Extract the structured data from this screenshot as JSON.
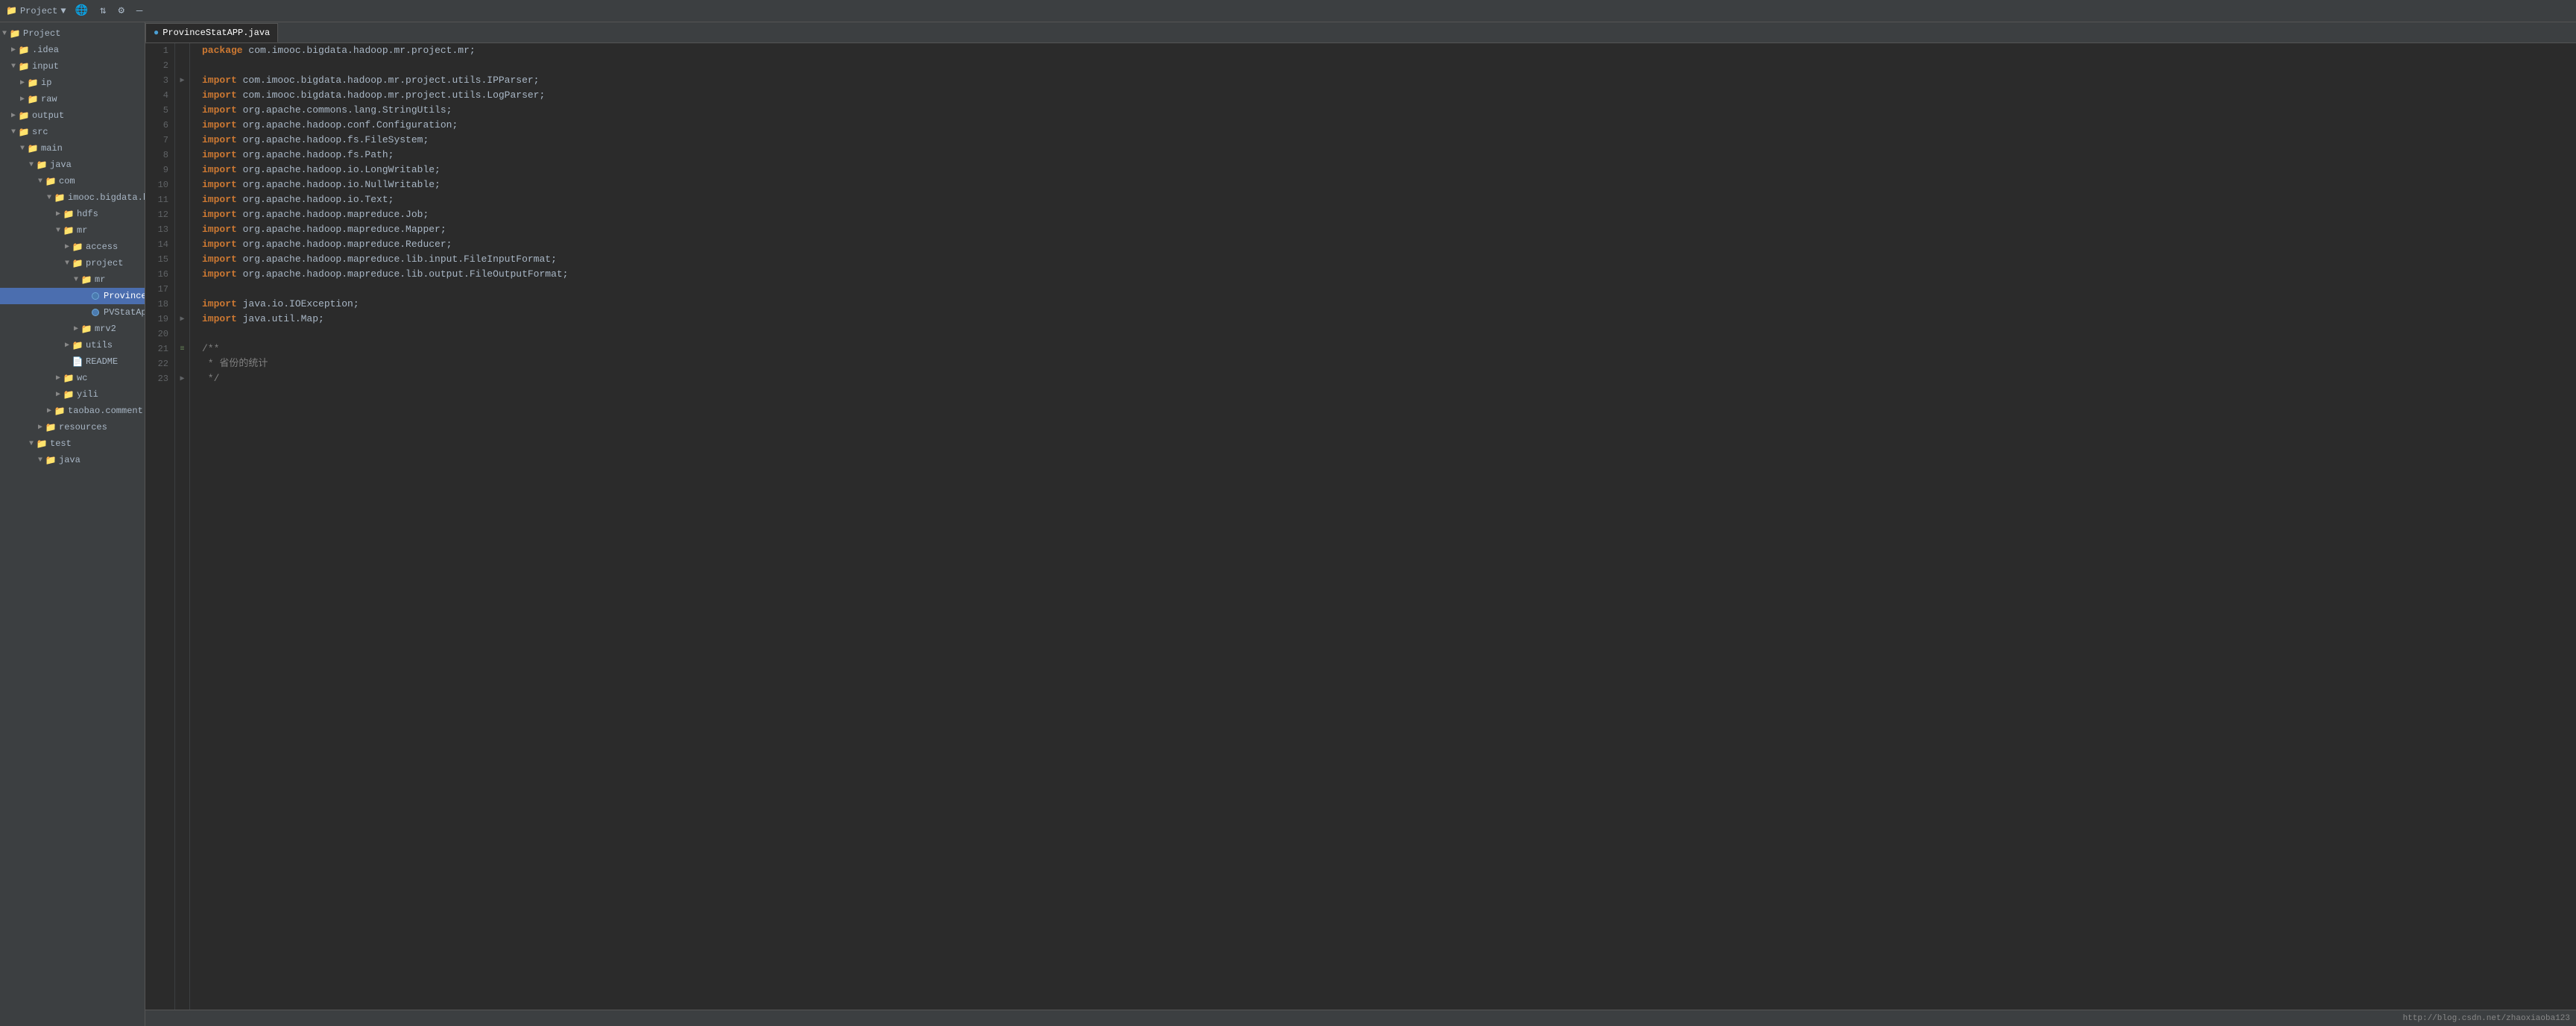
{
  "toolbar": {
    "project_label": "Project",
    "icons": [
      "🌐",
      "⇅",
      "⚙",
      "—"
    ]
  },
  "tab": {
    "filename": "ProvinceStatAPP.java",
    "icon_color": "#4b7baf"
  },
  "sidebar": {
    "items": [
      {
        "id": "project-root",
        "label": "Project",
        "indent": 0,
        "arrow": "▼",
        "icon": "📁",
        "icon_class": "folder-color"
      },
      {
        "id": "idea",
        "label": ".idea",
        "indent": 1,
        "arrow": "▶",
        "icon": "📁",
        "icon_class": "folder-color"
      },
      {
        "id": "input",
        "label": "input",
        "indent": 1,
        "arrow": "▼",
        "icon": "📁",
        "icon_class": "folder-color"
      },
      {
        "id": "ip",
        "label": "ip",
        "indent": 2,
        "arrow": "▶",
        "icon": "📁",
        "icon_class": "folder-color"
      },
      {
        "id": "raw",
        "label": "raw",
        "indent": 2,
        "arrow": "▶",
        "icon": "📁",
        "icon_class": "folder-color"
      },
      {
        "id": "output",
        "label": "output",
        "indent": 1,
        "arrow": "▶",
        "icon": "📁",
        "icon_class": "folder-color"
      },
      {
        "id": "src",
        "label": "src",
        "indent": 1,
        "arrow": "▼",
        "icon": "📁",
        "icon_class": "folder-color"
      },
      {
        "id": "main",
        "label": "main",
        "indent": 2,
        "arrow": "▼",
        "icon": "📁",
        "icon_class": "folder-color"
      },
      {
        "id": "java",
        "label": "java",
        "indent": 3,
        "arrow": "▼",
        "icon": "📁",
        "icon_class": "java-color"
      },
      {
        "id": "com",
        "label": "com",
        "indent": 4,
        "arrow": "▼",
        "icon": "📁",
        "icon_class": "folder-color"
      },
      {
        "id": "imooc",
        "label": "imooc.bigdata.hadoop",
        "indent": 5,
        "arrow": "▼",
        "icon": "📁",
        "icon_class": "folder-color"
      },
      {
        "id": "hdfs",
        "label": "hdfs",
        "indent": 6,
        "arrow": "▶",
        "icon": "📁",
        "icon_class": "folder-color"
      },
      {
        "id": "mr",
        "label": "mr",
        "indent": 6,
        "arrow": "▼",
        "icon": "📁",
        "icon_class": "folder-color"
      },
      {
        "id": "access",
        "label": "access",
        "indent": 7,
        "arrow": "▶",
        "icon": "📁",
        "icon_class": "folder-color"
      },
      {
        "id": "project",
        "label": "project",
        "indent": 7,
        "arrow": "▼",
        "icon": "📁",
        "icon_class": "folder-color"
      },
      {
        "id": "mr2",
        "label": "mr",
        "indent": 8,
        "arrow": "▼",
        "icon": "📁",
        "icon_class": "folder-color"
      },
      {
        "id": "ProvinceStatAPP",
        "label": "ProvinceStatAPP",
        "indent": 9,
        "arrow": "",
        "icon": "●",
        "icon_class": "blue-dot",
        "selected": true
      },
      {
        "id": "PVStatApp",
        "label": "PVStatApp",
        "indent": 9,
        "arrow": "",
        "icon": "●",
        "icon_class": "blue-dot"
      },
      {
        "id": "mrv2",
        "label": "mrv2",
        "indent": 8,
        "arrow": "▶",
        "icon": "📁",
        "icon_class": "folder-color"
      },
      {
        "id": "utils",
        "label": "utils",
        "indent": 7,
        "arrow": "▶",
        "icon": "📁",
        "icon_class": "folder-color"
      },
      {
        "id": "README",
        "label": "README",
        "indent": 7,
        "arrow": "",
        "icon": "📄",
        "icon_class": ""
      },
      {
        "id": "wc",
        "label": "wc",
        "indent": 6,
        "arrow": "▶",
        "icon": "📁",
        "icon_class": "folder-color"
      },
      {
        "id": "yili",
        "label": "yili",
        "indent": 6,
        "arrow": "▶",
        "icon": "📁",
        "icon_class": "folder-color"
      },
      {
        "id": "taobao",
        "label": "taobao.comment.hadoop",
        "indent": 5,
        "arrow": "▶",
        "icon": "📁",
        "icon_class": "folder-color"
      },
      {
        "id": "resources",
        "label": "resources",
        "indent": 4,
        "arrow": "▶",
        "icon": "📁",
        "icon_class": "folder-color"
      },
      {
        "id": "test",
        "label": "test",
        "indent": 3,
        "arrow": "▼",
        "icon": "📁",
        "icon_class": "folder-color"
      },
      {
        "id": "java2",
        "label": "java",
        "indent": 4,
        "arrow": "▼",
        "icon": "📁",
        "icon_class": "java-color"
      }
    ]
  },
  "code": {
    "lines": [
      {
        "n": 1,
        "gutter": "",
        "tokens": [
          {
            "t": "package ",
            "c": "kw"
          },
          {
            "t": "com.imooc.bigdata.hadoop.mr.project.mr;",
            "c": "pkg"
          }
        ]
      },
      {
        "n": 2,
        "gutter": "",
        "tokens": []
      },
      {
        "n": 3,
        "gutter": "▶",
        "tokens": [
          {
            "t": "import ",
            "c": "import-kw"
          },
          {
            "t": "com.imooc.bigdata.hadoop.mr.project.utils.IPParser;",
            "c": "pkg"
          }
        ]
      },
      {
        "n": 4,
        "gutter": "",
        "tokens": [
          {
            "t": "import ",
            "c": "import-kw"
          },
          {
            "t": "com.imooc.bigdata.hadoop.mr.project.utils.LogParser;",
            "c": "pkg"
          }
        ]
      },
      {
        "n": 5,
        "gutter": "",
        "tokens": [
          {
            "t": "import ",
            "c": "import-kw"
          },
          {
            "t": "org.apache.commons.lang.StringUtils;",
            "c": "pkg"
          }
        ]
      },
      {
        "n": 6,
        "gutter": "",
        "tokens": [
          {
            "t": "import ",
            "c": "import-kw"
          },
          {
            "t": "org.apache.hadoop.conf.Configuration;",
            "c": "pkg"
          }
        ]
      },
      {
        "n": 7,
        "gutter": "",
        "tokens": [
          {
            "t": "import ",
            "c": "import-kw"
          },
          {
            "t": "org.apache.hadoop.fs.FileSystem;",
            "c": "pkg"
          }
        ]
      },
      {
        "n": 8,
        "gutter": "",
        "tokens": [
          {
            "t": "import ",
            "c": "import-kw"
          },
          {
            "t": "org.apache.hadoop.fs.Path;",
            "c": "pkg"
          }
        ]
      },
      {
        "n": 9,
        "gutter": "",
        "tokens": [
          {
            "t": "import ",
            "c": "import-kw"
          },
          {
            "t": "org.apache.hadoop.io.LongWritable;",
            "c": "pkg"
          }
        ]
      },
      {
        "n": 10,
        "gutter": "",
        "tokens": [
          {
            "t": "import ",
            "c": "import-kw"
          },
          {
            "t": "org.apache.hadoop.io.NullWritable;",
            "c": "pkg"
          }
        ]
      },
      {
        "n": 11,
        "gutter": "",
        "tokens": [
          {
            "t": "import ",
            "c": "import-kw"
          },
          {
            "t": "org.apache.hadoop.io.Text;",
            "c": "pkg"
          }
        ]
      },
      {
        "n": 12,
        "gutter": "",
        "tokens": [
          {
            "t": "import ",
            "c": "import-kw"
          },
          {
            "t": "org.apache.hadoop.mapreduce.Job;",
            "c": "pkg"
          }
        ]
      },
      {
        "n": 13,
        "gutter": "",
        "tokens": [
          {
            "t": "import ",
            "c": "import-kw"
          },
          {
            "t": "org.apache.hadoop.mapreduce.Mapper;",
            "c": "pkg"
          }
        ]
      },
      {
        "n": 14,
        "gutter": "",
        "tokens": [
          {
            "t": "import ",
            "c": "import-kw"
          },
          {
            "t": "org.apache.hadoop.mapreduce.Reducer;",
            "c": "pkg"
          }
        ]
      },
      {
        "n": 15,
        "gutter": "",
        "tokens": [
          {
            "t": "import ",
            "c": "import-kw"
          },
          {
            "t": "org.apache.hadoop.mapreduce.lib.input.FileInputFormat;",
            "c": "pkg"
          }
        ]
      },
      {
        "n": 16,
        "gutter": "",
        "tokens": [
          {
            "t": "import ",
            "c": "import-kw"
          },
          {
            "t": "org.apache.hadoop.mapreduce.lib.output.FileOutputFormat;",
            "c": "pkg"
          }
        ]
      },
      {
        "n": 17,
        "gutter": "",
        "tokens": []
      },
      {
        "n": 18,
        "gutter": "",
        "tokens": [
          {
            "t": "import ",
            "c": "import-kw"
          },
          {
            "t": "java.io.IOException;",
            "c": "pkg"
          }
        ]
      },
      {
        "n": 19,
        "gutter": "▶",
        "tokens": [
          {
            "t": "import ",
            "c": "import-kw"
          },
          {
            "t": "java.util.Map;",
            "c": "pkg"
          }
        ]
      },
      {
        "n": 20,
        "gutter": "",
        "tokens": []
      },
      {
        "n": 21,
        "gutter": "≡",
        "tokens": [
          {
            "t": "/**",
            "c": "comment"
          }
        ]
      },
      {
        "n": 22,
        "gutter": "",
        "tokens": [
          {
            "t": " * 省份的统计",
            "c": "comment"
          }
        ]
      },
      {
        "n": 23,
        "gutter": "▶",
        "tokens": [
          {
            "t": " */",
            "c": "comment"
          }
        ]
      }
    ]
  },
  "status_bar": {
    "url": "http://blog.csdn.net/zhaoxiaoba123"
  }
}
